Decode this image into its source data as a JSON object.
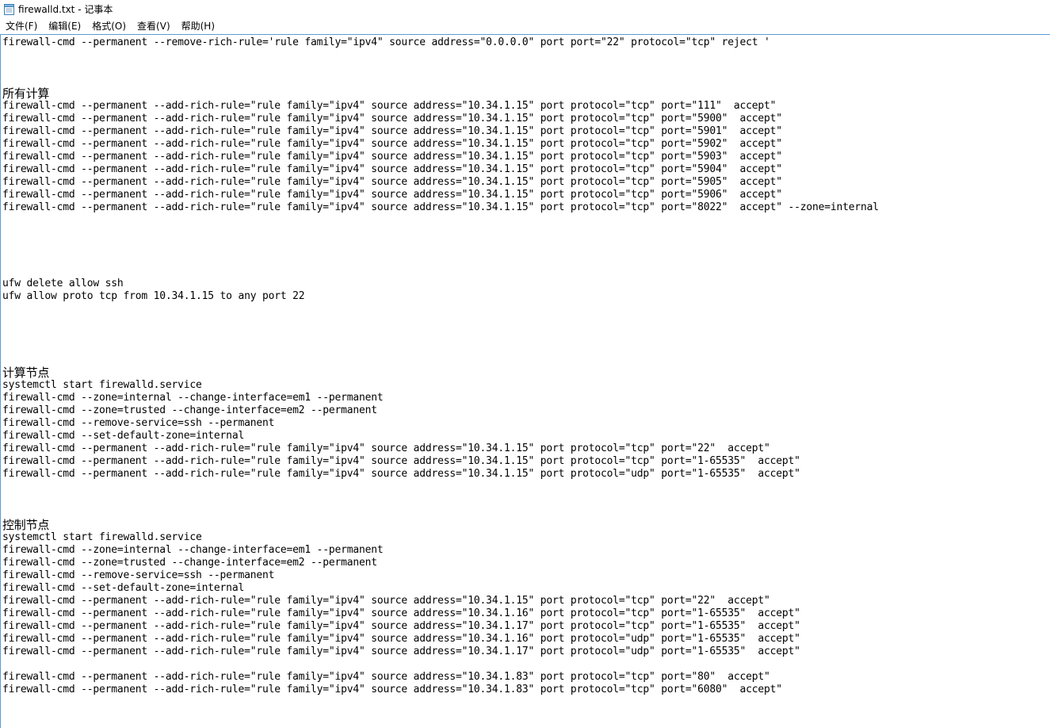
{
  "window": {
    "title": "firewalld.txt - 记事本"
  },
  "menu": {
    "items": [
      "文件(F)",
      "编辑(E)",
      "格式(O)",
      "查看(V)",
      "帮助(H)"
    ]
  },
  "editor": {
    "lines": [
      "firewall-cmd --permanent --remove-rich-rule='rule family=\"ipv4\" source address=\"0.0.0.0\" port port=\"22\" protocol=\"tcp\" reject '",
      "",
      "",
      "",
      "所有计算",
      "firewall-cmd --permanent --add-rich-rule=\"rule family=\"ipv4\" source address=\"10.34.1.15\" port protocol=\"tcp\" port=\"111\"  accept\"",
      "firewall-cmd --permanent --add-rich-rule=\"rule family=\"ipv4\" source address=\"10.34.1.15\" port protocol=\"tcp\" port=\"5900\"  accept\"",
      "firewall-cmd --permanent --add-rich-rule=\"rule family=\"ipv4\" source address=\"10.34.1.15\" port protocol=\"tcp\" port=\"5901\"  accept\"",
      "firewall-cmd --permanent --add-rich-rule=\"rule family=\"ipv4\" source address=\"10.34.1.15\" port protocol=\"tcp\" port=\"5902\"  accept\"",
      "firewall-cmd --permanent --add-rich-rule=\"rule family=\"ipv4\" source address=\"10.34.1.15\" port protocol=\"tcp\" port=\"5903\"  accept\"",
      "firewall-cmd --permanent --add-rich-rule=\"rule family=\"ipv4\" source address=\"10.34.1.15\" port protocol=\"tcp\" port=\"5904\"  accept\"",
      "firewall-cmd --permanent --add-rich-rule=\"rule family=\"ipv4\" source address=\"10.34.1.15\" port protocol=\"tcp\" port=\"5905\"  accept\"",
      "firewall-cmd --permanent --add-rich-rule=\"rule family=\"ipv4\" source address=\"10.34.1.15\" port protocol=\"tcp\" port=\"5906\"  accept\"",
      "firewall-cmd --permanent --add-rich-rule=\"rule family=\"ipv4\" source address=\"10.34.1.15\" port protocol=\"tcp\" port=\"8022\"  accept\" --zone=internal",
      "",
      "",
      "",
      "",
      "",
      "ufw delete allow ssh",
      "ufw allow proto tcp from 10.34.1.15 to any port 22",
      "",
      "",
      "",
      "",
      "",
      "计算节点",
      "systemctl start firewalld.service",
      "firewall-cmd --zone=internal --change-interface=em1 --permanent",
      "firewall-cmd --zone=trusted --change-interface=em2 --permanent",
      "firewall-cmd --remove-service=ssh --permanent",
      "firewall-cmd --set-default-zone=internal",
      "firewall-cmd --permanent --add-rich-rule=\"rule family=\"ipv4\" source address=\"10.34.1.15\" port protocol=\"tcp\" port=\"22\"  accept\"",
      "firewall-cmd --permanent --add-rich-rule=\"rule family=\"ipv4\" source address=\"10.34.1.15\" port protocol=\"tcp\" port=\"1-65535\"  accept\"",
      "firewall-cmd --permanent --add-rich-rule=\"rule family=\"ipv4\" source address=\"10.34.1.15\" port protocol=\"udp\" port=\"1-65535\"  accept\"",
      "",
      "",
      "",
      "控制节点",
      "systemctl start firewalld.service",
      "firewall-cmd --zone=internal --change-interface=em1 --permanent",
      "firewall-cmd --zone=trusted --change-interface=em2 --permanent",
      "firewall-cmd --remove-service=ssh --permanent",
      "firewall-cmd --set-default-zone=internal",
      "firewall-cmd --permanent --add-rich-rule=\"rule family=\"ipv4\" source address=\"10.34.1.15\" port protocol=\"tcp\" port=\"22\"  accept\"",
      "firewall-cmd --permanent --add-rich-rule=\"rule family=\"ipv4\" source address=\"10.34.1.16\" port protocol=\"tcp\" port=\"1-65535\"  accept\"",
      "firewall-cmd --permanent --add-rich-rule=\"rule family=\"ipv4\" source address=\"10.34.1.17\" port protocol=\"tcp\" port=\"1-65535\"  accept\"",
      "firewall-cmd --permanent --add-rich-rule=\"rule family=\"ipv4\" source address=\"10.34.1.16\" port protocol=\"udp\" port=\"1-65535\"  accept\"",
      "firewall-cmd --permanent --add-rich-rule=\"rule family=\"ipv4\" source address=\"10.34.1.17\" port protocol=\"udp\" port=\"1-65535\"  accept\"",
      "",
      "firewall-cmd --permanent --add-rich-rule=\"rule family=\"ipv4\" source address=\"10.34.1.83\" port protocol=\"tcp\" port=\"80\"  accept\"",
      "firewall-cmd --permanent --add-rich-rule=\"rule family=\"ipv4\" source address=\"10.34.1.83\" port protocol=\"tcp\" port=\"6080\"  accept\""
    ]
  }
}
